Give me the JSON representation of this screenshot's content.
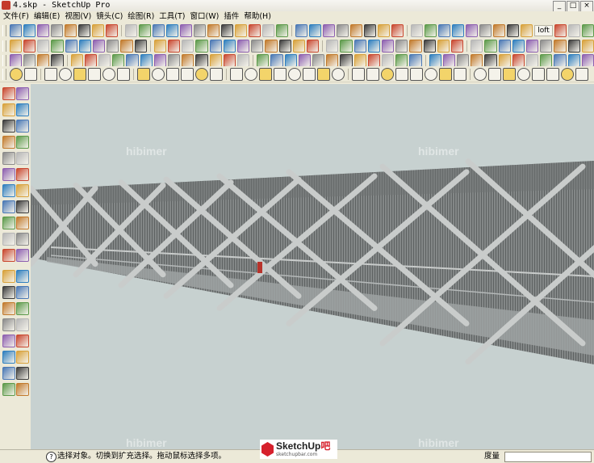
{
  "window": {
    "title": "4.skp - SketchUp Pro",
    "min_glyph": "_",
    "max_glyph": "□",
    "close_glyph": "×"
  },
  "menu": [
    "文件(F)",
    "编辑(E)",
    "视图(V)",
    "镜头(C)",
    "绘图(R)",
    "工具(T)",
    "窗口(W)",
    "插件",
    "帮助(H)"
  ],
  "toolbar": {
    "loft_label": "loft"
  },
  "status": {
    "help_glyph": "?",
    "message": "选择对象。切换到扩充选择。拖动鼠标选择多项。",
    "measure_label": "度量",
    "measure_value": ""
  },
  "watermark": {
    "text": "hibimer"
  },
  "logo": {
    "brand_main": "SketchUp",
    "brand_suffix": "吧",
    "site": "sketchupbar.com"
  },
  "colors": {
    "viewport_bg": "#c7d1d0",
    "tube": "#7e8282",
    "band": "#c9cccb",
    "accent": "#d6202c"
  }
}
